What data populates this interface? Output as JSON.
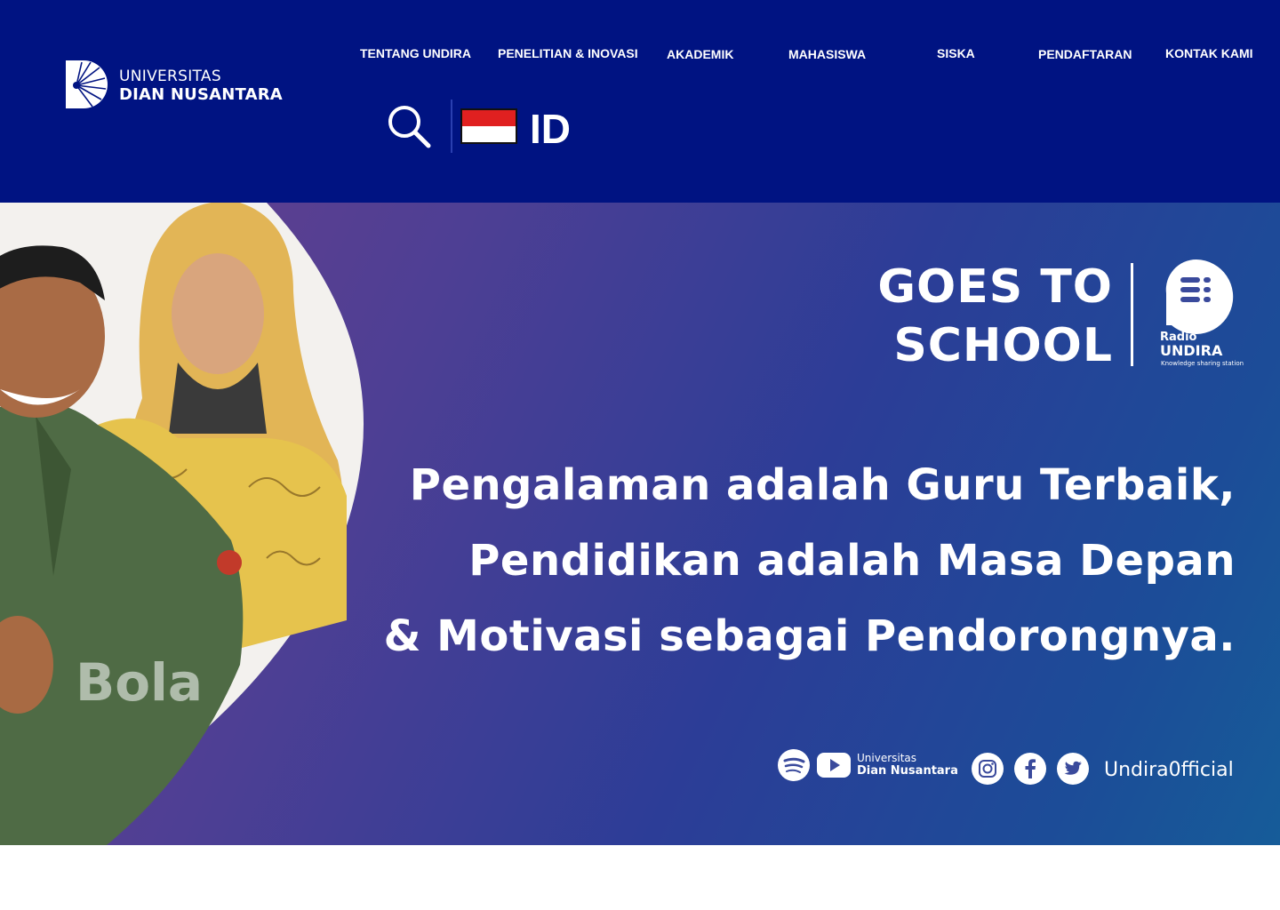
{
  "header": {
    "logo": {
      "line1": "UNIVERSITAS",
      "line2": "DIAN NUSANTARA"
    },
    "nav": [
      {
        "label": "TENTANG UNDIRA"
      },
      {
        "label": "PENELITIAN & INOVASI"
      },
      {
        "label": "AKADEMIK"
      },
      {
        "label": "MAHASISWA"
      },
      {
        "label": "SISKA"
      },
      {
        "label": "PENDAFTARAN"
      },
      {
        "label": "KONTAK KAMI"
      }
    ],
    "search_icon": "search-icon",
    "language": {
      "code": "ID",
      "flag": "indonesia-flag"
    }
  },
  "banner": {
    "goes_line1": "GOES TO",
    "goes_line2": "SCHOOL",
    "radio": {
      "line1": "Radio",
      "line2": "UNDIRA",
      "tagline": "Knowledge sharing station"
    },
    "quote": [
      "Pengalaman adalah Guru Terbaik,",
      "Pendidikan adalah Masa Depan",
      "& Motivasi sebagai Pendorongnya."
    ],
    "social": {
      "channel_line1": "Universitas",
      "channel_line2": "Dian Nusantara",
      "handle": "Undira0fficial",
      "icons": [
        "spotify-icon",
        "youtube-icon",
        "instagram-icon",
        "facebook-icon",
        "twitter-icon"
      ]
    },
    "photo_watermark": "Bola"
  },
  "colors": {
    "header_bg": "#001382",
    "banner_start": "#6a3f8c",
    "banner_end": "#165c99",
    "flag_red": "#e02020"
  }
}
